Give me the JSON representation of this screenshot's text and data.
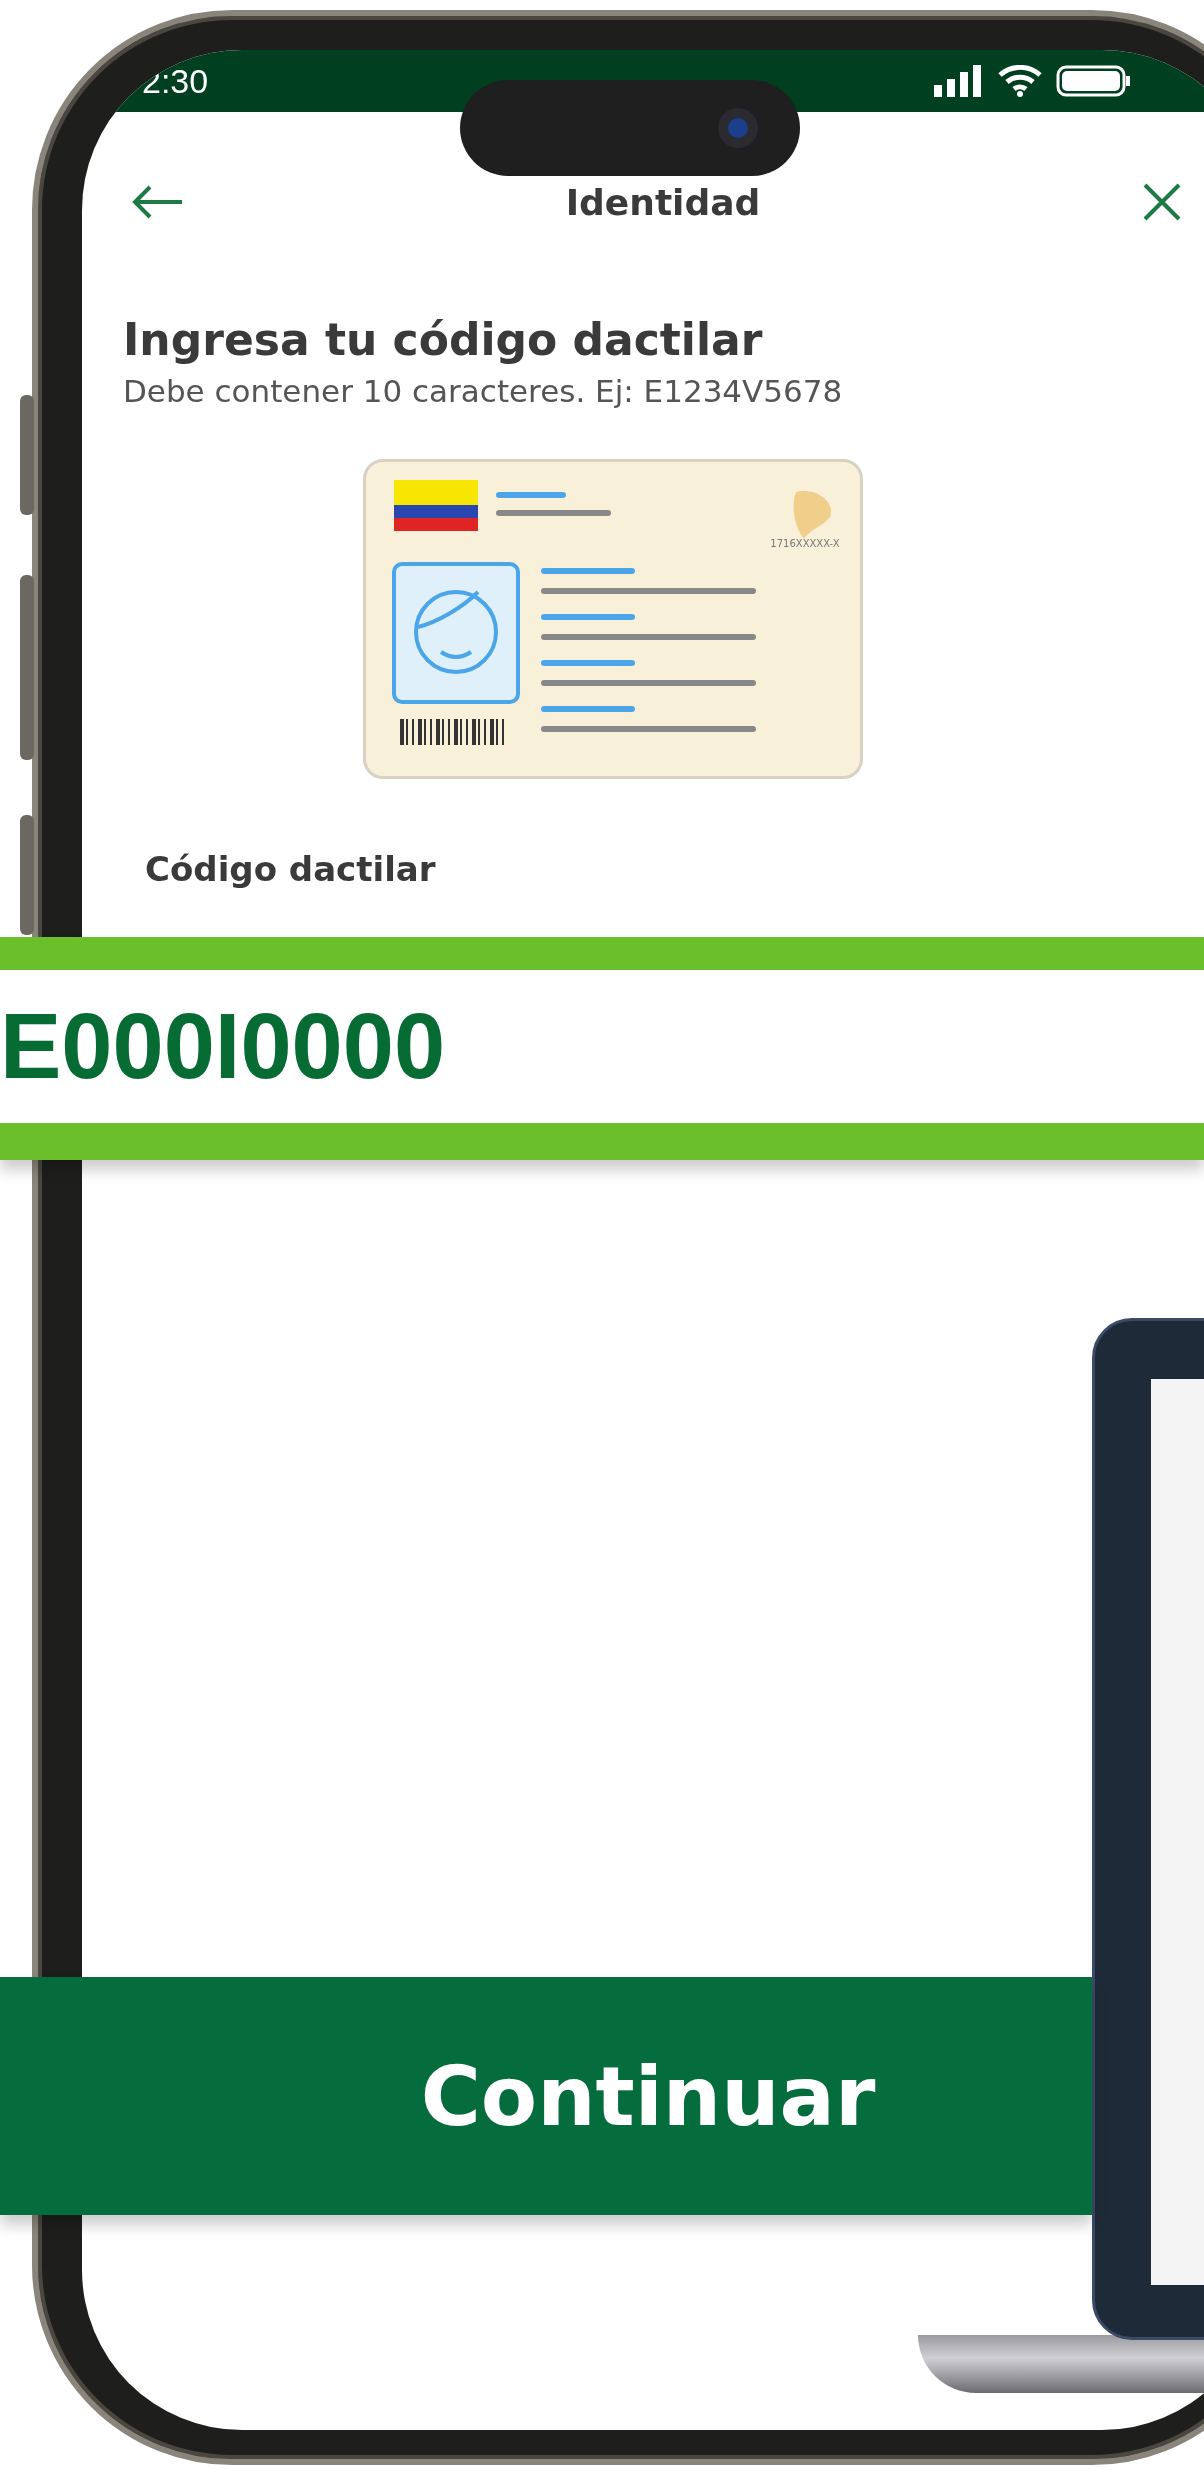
{
  "status_bar": {
    "time": "2:30"
  },
  "header": {
    "title": "Identidad"
  },
  "heading": "Ingresa tu código dactilar",
  "hint": "Debe contener 10 caracteres. Ej: E1234V5678",
  "id_card": {
    "number": "1716XXXXX-X"
  },
  "field": {
    "label": "Código dactilar",
    "value": "E000I0000"
  },
  "button": {
    "label": "Continuar"
  }
}
